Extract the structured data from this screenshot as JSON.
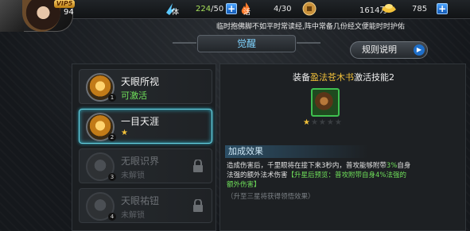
{
  "player": {
    "level": "94",
    "vip": "VIP5"
  },
  "resources": {
    "stamina": {
      "label": "体",
      "value": "224",
      "max": "/50"
    },
    "vitality": {
      "label": "活",
      "value": "4/30"
    },
    "coins": {
      "value": "1614万"
    },
    "gold": {
      "value": "785"
    }
  },
  "marquee": "临时抱佛脚不如平时常读经,阵中常备几份经文便能时时护佑",
  "title": "觉醒",
  "rules_button": "规则说明",
  "skills": [
    {
      "name": "天眼所视",
      "status": "可激活",
      "num": "1",
      "locked": false
    },
    {
      "name": "一目天涯",
      "status": "★",
      "num": "2",
      "locked": false,
      "selected": true
    },
    {
      "name": "无眼识界",
      "status": "未解锁",
      "num": "3",
      "locked": true
    },
    {
      "name": "天眼祐钮",
      "status": "未解锁",
      "num": "4",
      "locked": true
    }
  ],
  "detail": {
    "equip_prefix": "装备",
    "equip_item": "盈法苍木书",
    "equip_suffix": "激活技能2",
    "stars_on": "★",
    "stars_off": "★★★★",
    "effect_title": "加成效果",
    "effect_line1_a": "造成伤害后，千里眼将在接下来3秒内，普攻能够附带",
    "effect_line1_hl": "3%",
    "effect_line1_b": "自身",
    "effect_line2_a": "法强的额外法术伤害",
    "effect_line2_hl": "【升星后预览：普攻附带自身4%法强的",
    "effect_line3_hl": "额外伤害】",
    "note": "（升至三星将获得领悟效果）"
  },
  "colors": {
    "accent": "#6ad6e6",
    "gold": "#f2c13a",
    "green": "#6fe05a",
    "title": "#7fd3ff"
  }
}
